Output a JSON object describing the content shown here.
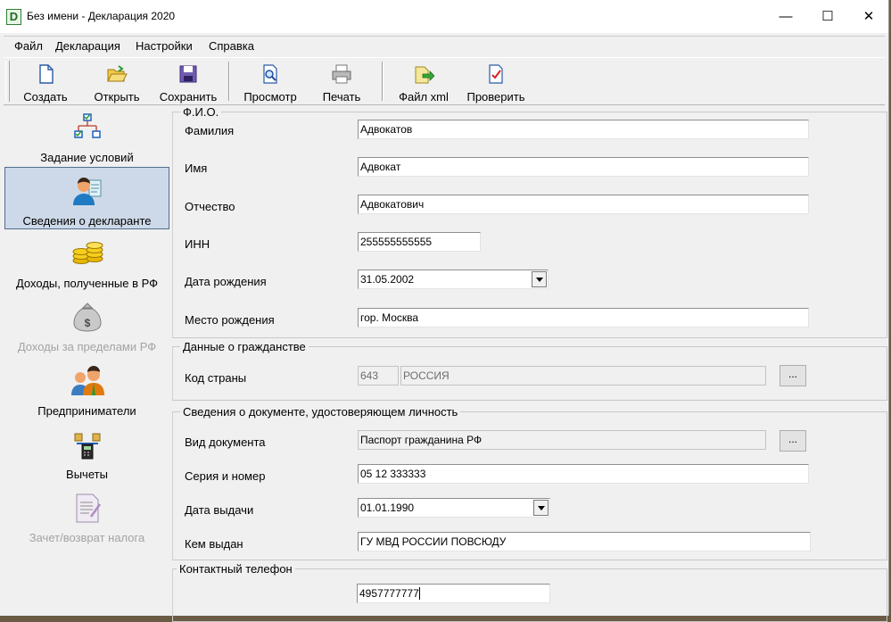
{
  "window": {
    "title": "Без имени - Декларация 2020",
    "icon_letter": "D",
    "minimize": "—",
    "maximize": "☐",
    "close": "✕"
  },
  "menu": [
    "Файл",
    "Декларация",
    "Настройки",
    "Справка"
  ],
  "toolbar": [
    {
      "label": "Создать",
      "icon": "new-document-icon"
    },
    {
      "label": "Открыть",
      "icon": "open-folder-icon"
    },
    {
      "label": "Сохранить",
      "icon": "save-disk-icon"
    },
    {
      "label": "Просмотр",
      "icon": "preview-icon"
    },
    {
      "label": "Печать",
      "icon": "printer-icon"
    },
    {
      "label": "Файл xml",
      "icon": "export-xml-icon"
    },
    {
      "label": "Проверить",
      "icon": "check-document-icon"
    }
  ],
  "sidebar": [
    {
      "label": "Задание условий",
      "icon": "conditions-tree-icon",
      "selected": false,
      "disabled": false
    },
    {
      "label": "Сведения о декларанте",
      "icon": "declarant-person-icon",
      "selected": true,
      "disabled": false
    },
    {
      "label": "Доходы, полученные в РФ",
      "icon": "coins-icon",
      "selected": false,
      "disabled": false
    },
    {
      "label": "Доходы за пределами РФ",
      "icon": "money-bag-icon",
      "selected": false,
      "disabled": true
    },
    {
      "label": "Предприниматели",
      "icon": "businessmen-icon",
      "selected": false,
      "disabled": false
    },
    {
      "label": "Вычеты",
      "icon": "deductions-icon",
      "selected": false,
      "disabled": false
    },
    {
      "label": "Зачет/возврат налога",
      "icon": "tax-refund-icon",
      "selected": false,
      "disabled": true
    }
  ],
  "fio": {
    "legend": "Ф.И.О.",
    "last_name_label": "Фамилия",
    "last_name": "Адвокатов",
    "first_name_label": "Имя",
    "first_name": "Адвокат",
    "patronymic_label": "Отчество",
    "patronymic": "Адвокатович",
    "inn_label": "ИНН",
    "inn": "255555555555",
    "birth_date_label": "Дата рождения",
    "birth_date": "31.05.2002",
    "birth_place_label": "Место рождения",
    "birth_place": "гор. Москва"
  },
  "citizenship": {
    "legend": "Данные о гражданстве",
    "country_code_label": "Код страны",
    "country_code": "643",
    "country_name": "РОССИЯ",
    "browse": "..."
  },
  "document": {
    "legend": "Сведения о документе, удостоверяющем личность",
    "type_label": "Вид документа",
    "type": "Паспорт гражданина РФ",
    "browse": "...",
    "series_label": "Серия и номер",
    "series": "05 12 333333",
    "issue_date_label": "Дата выдачи",
    "issue_date": "01.01.1990",
    "issued_by_label": "Кем выдан",
    "issued_by": "ГУ МВД РОССИИ ПОВСЮДУ"
  },
  "contact": {
    "legend": "Контактный телефон",
    "phone": "4957777777"
  },
  "colors": {
    "selection_bg": "#cdd9e8",
    "selection_border": "#516d8f",
    "window_bg": "#f0f0f0"
  }
}
